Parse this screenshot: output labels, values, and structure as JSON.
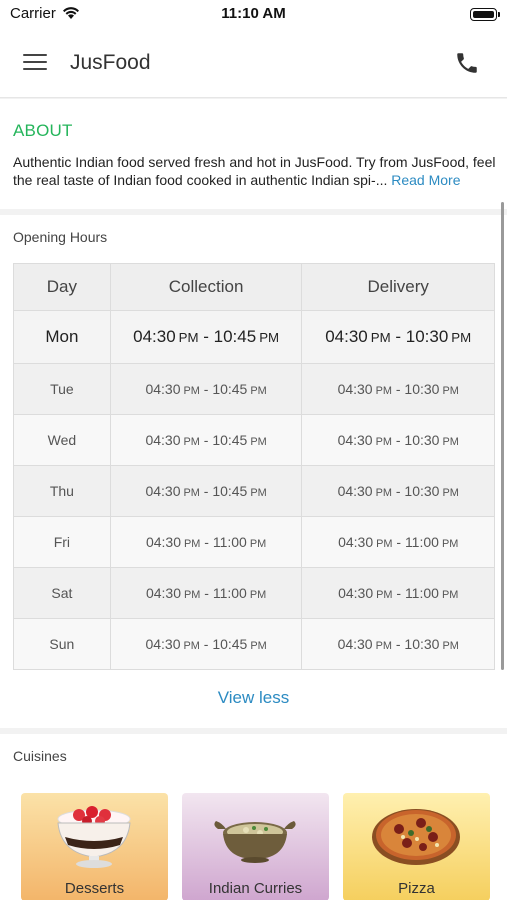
{
  "status_bar": {
    "carrier": "Carrier",
    "time": "11:10 AM"
  },
  "nav": {
    "title": "JusFood",
    "menu_icon": "hamburger-menu-icon",
    "phone_icon": "phone-icon"
  },
  "about": {
    "heading": "ABOUT",
    "text": "Authentic Indian food served fresh and hot in JusFood. Try from JusFood, feel the real taste of Indian food cooked in authentic Indian spi-...",
    "read_more": "Read More"
  },
  "opening_hours": {
    "heading": "Opening Hours",
    "columns": [
      "Day",
      "Collection",
      "Delivery"
    ],
    "rows": [
      {
        "day": "Mon",
        "collection_from": "04:30",
        "collection_from_ampm": "PM",
        "collection_to": "10:45",
        "collection_to_ampm": "PM",
        "delivery_from": "04:30",
        "delivery_from_ampm": "PM",
        "delivery_to": "10:30",
        "delivery_to_ampm": "PM"
      },
      {
        "day": "Tue",
        "collection_from": "04:30",
        "collection_from_ampm": "PM",
        "collection_to": "10:45",
        "collection_to_ampm": "PM",
        "delivery_from": "04:30",
        "delivery_from_ampm": "PM",
        "delivery_to": "10:30",
        "delivery_to_ampm": "PM"
      },
      {
        "day": "Wed",
        "collection_from": "04:30",
        "collection_from_ampm": "PM",
        "collection_to": "10:45",
        "collection_to_ampm": "PM",
        "delivery_from": "04:30",
        "delivery_from_ampm": "PM",
        "delivery_to": "10:30",
        "delivery_to_ampm": "PM"
      },
      {
        "day": "Thu",
        "collection_from": "04:30",
        "collection_from_ampm": "PM",
        "collection_to": "10:45",
        "collection_to_ampm": "PM",
        "delivery_from": "04:30",
        "delivery_from_ampm": "PM",
        "delivery_to": "10:30",
        "delivery_to_ampm": "PM"
      },
      {
        "day": "Fri",
        "collection_from": "04:30",
        "collection_from_ampm": "PM",
        "collection_to": "11:00",
        "collection_to_ampm": "PM",
        "delivery_from": "04:30",
        "delivery_from_ampm": "PM",
        "delivery_to": "11:00",
        "delivery_to_ampm": "PM"
      },
      {
        "day": "Sat",
        "collection_from": "04:30",
        "collection_from_ampm": "PM",
        "collection_to": "11:00",
        "collection_to_ampm": "PM",
        "delivery_from": "04:30",
        "delivery_from_ampm": "PM",
        "delivery_to": "11:00",
        "delivery_to_ampm": "PM"
      },
      {
        "day": "Sun",
        "collection_from": "04:30",
        "collection_from_ampm": "PM",
        "collection_to": "10:45",
        "collection_to_ampm": "PM",
        "delivery_from": "04:30",
        "delivery_from_ampm": "PM",
        "delivery_to": "10:30",
        "delivery_to_ampm": "PM"
      }
    ],
    "view_less": "View less"
  },
  "cuisines": {
    "heading": "Cuisines",
    "items": [
      {
        "label": "Desserts",
        "icon": "dessert-bowl-icon",
        "color_top": "#fbe2a8",
        "color_bottom": "#f3b56a"
      },
      {
        "label": "Indian Curries",
        "icon": "curry-pot-icon",
        "color_top": "#f2e6f0",
        "color_bottom": "#cfa6cf"
      },
      {
        "label": "Pizza",
        "icon": "pizza-icon",
        "color_top": "#fff0b0",
        "color_bottom": "#f5cf5e"
      }
    ]
  },
  "colors": {
    "accent_green": "#25b55b",
    "link_blue": "#2c8bc2"
  }
}
